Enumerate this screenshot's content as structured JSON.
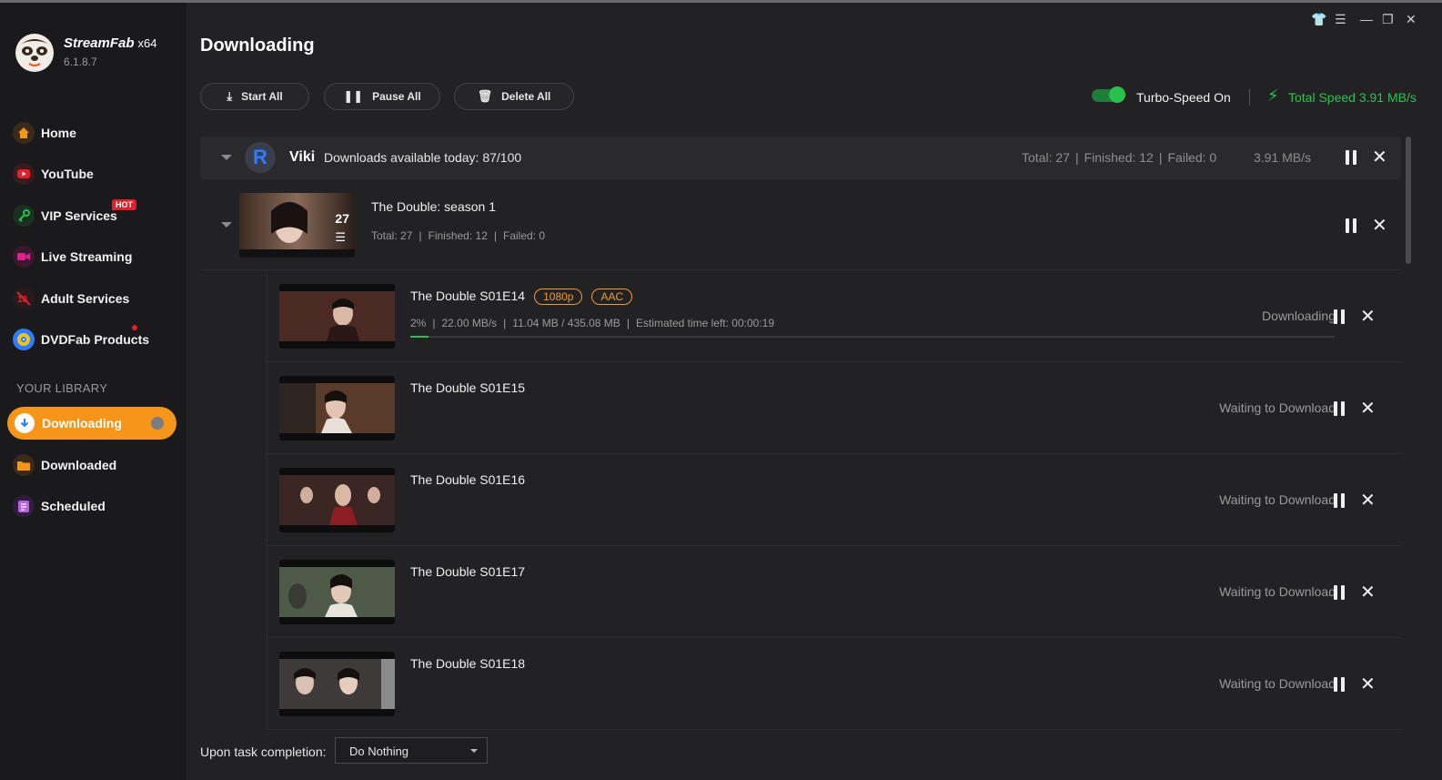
{
  "app": {
    "brand": "StreamFab",
    "arch": "x64",
    "version": "6.1.8.7"
  },
  "sidebar": {
    "items": [
      {
        "label": "Home",
        "icon": "home-icon",
        "color": "#f5961b"
      },
      {
        "label": "YouTube",
        "icon": "youtube-icon",
        "color": "#e0202b"
      },
      {
        "label": "VIP Services",
        "icon": "key-icon",
        "color": "#2ac14a",
        "badge": "HOT"
      },
      {
        "label": "Live Streaming",
        "icon": "video-camera-icon",
        "color": "#e0208b"
      },
      {
        "label": "Adult Services",
        "icon": "adult-block-icon",
        "color": "#e0202b"
      },
      {
        "label": "DVDFab Products",
        "icon": "dvdfab-icon",
        "color": "#2f7dff"
      }
    ],
    "library_title": "YOUR LIBRARY",
    "library": [
      {
        "label": "Downloading",
        "icon": "download-icon",
        "active": true
      },
      {
        "label": "Downloaded",
        "icon": "folder-icon",
        "color": "#f5961b"
      },
      {
        "label": "Scheduled",
        "icon": "calendar-icon",
        "color": "#b464e0"
      }
    ]
  },
  "header": {
    "title": "Downloading",
    "buttons": {
      "start_all": "Start All",
      "pause_all": "Pause All",
      "delete_all": "Delete All"
    },
    "turbo_label": "Turbo-Speed On",
    "turbo_on": true,
    "total_speed": "Total Speed 3.91 MB/s"
  },
  "group": {
    "name": "Viki",
    "avail": "Downloads available today: 87/100",
    "total": "Total: 27",
    "finished": "Finished: 12",
    "failed": "Failed: 0",
    "speed": "3.91 MB/s"
  },
  "season": {
    "title": "The Double: season 1",
    "count": "27",
    "total": "Total: 27",
    "finished": "Finished: 12",
    "failed": "Failed: 0"
  },
  "episodes": [
    {
      "title": "The Double S01E14",
      "tags": [
        "1080p",
        "AAC"
      ],
      "percent": "2%",
      "progress": 0.02,
      "speed": "22.00 MB/s",
      "size": "11.04 MB / 435.08 MB",
      "eta": "Estimated time left: 00:00:19",
      "status": "Downloading"
    },
    {
      "title": "The Double S01E15",
      "status": "Waiting to Download"
    },
    {
      "title": "The Double S01E16",
      "status": "Waiting to Download"
    },
    {
      "title": "The Double S01E17",
      "status": "Waiting to Download"
    },
    {
      "title": "The Double S01E18",
      "status": "Waiting to Download"
    }
  ],
  "footer": {
    "label": "Upon task completion:",
    "selected": "Do Nothing"
  },
  "colors": {
    "accent": "#f5961b",
    "green": "#2bc24d",
    "tag": "#f39a2a"
  }
}
